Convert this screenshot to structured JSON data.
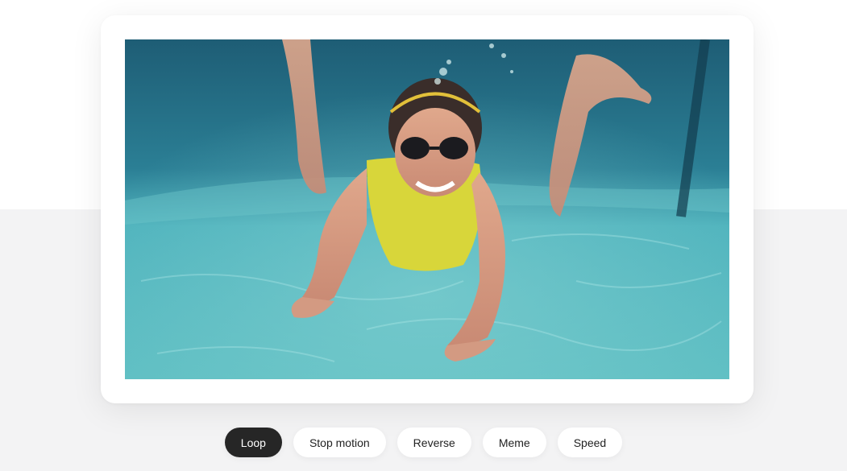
{
  "media": {
    "image": "underwater-swimmer-photo",
    "colors": {
      "water": "#3ea6b4",
      "deep": "#1c5a72",
      "swimsuit": "#d8d63a",
      "skin": "#d79a7e"
    }
  },
  "modes": [
    {
      "label": "Loop",
      "active": true
    },
    {
      "label": "Stop motion",
      "active": false
    },
    {
      "label": "Reverse",
      "active": false
    },
    {
      "label": "Meme",
      "active": false
    },
    {
      "label": "Speed",
      "active": false
    }
  ]
}
